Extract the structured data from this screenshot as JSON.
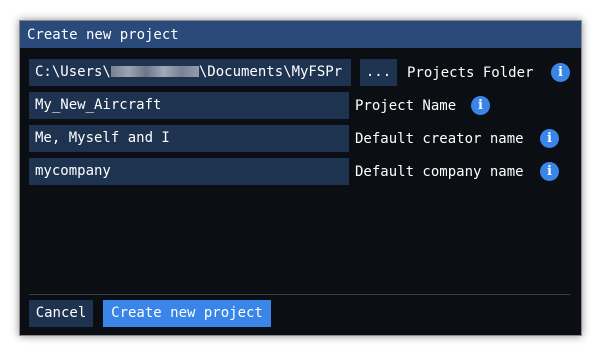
{
  "dialog": {
    "title": "Create new project"
  },
  "projects_folder": {
    "value_prefix": "C:\\Users\\",
    "value_suffix": "\\Documents\\MyFSPr",
    "browse_label": "...",
    "label": "Projects Folder"
  },
  "project_name": {
    "value": "My_New_Aircraft",
    "label": "Project Name"
  },
  "creator_name": {
    "value": "Me, Myself and I",
    "label": "Default creator name"
  },
  "company_name": {
    "value": "mycompany",
    "label": "Default company name"
  },
  "info_icon_glyph": "i",
  "buttons": {
    "cancel": "Cancel",
    "create": "Create new project"
  },
  "colors": {
    "title_bar": "#294a7a",
    "background": "#0b0e12",
    "field": "#1e3350",
    "accent": "#3a86e8"
  }
}
